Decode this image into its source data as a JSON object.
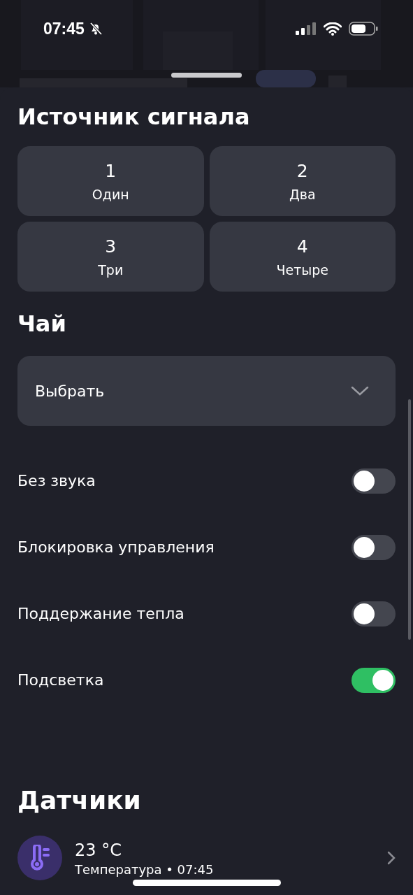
{
  "status_bar": {
    "time": "07:45",
    "silent": true
  },
  "signal_source": {
    "title": "Источник сигнала",
    "options": [
      {
        "number": "1",
        "label": "Один",
        "selected": false
      },
      {
        "number": "2",
        "label": "Два",
        "selected": false
      },
      {
        "number": "3",
        "label": "Три",
        "selected": false
      },
      {
        "number": "4",
        "label": "Четыре",
        "selected": false
      }
    ]
  },
  "tea": {
    "title": "Чай",
    "select": {
      "value": "Выбрать"
    }
  },
  "toggles": [
    {
      "label": "Без звука",
      "on": false
    },
    {
      "label": "Блокировка управления",
      "on": false
    },
    {
      "label": "Поддержание тепла",
      "on": false
    },
    {
      "label": "Подсветка",
      "on": true
    }
  ],
  "sensors": {
    "title": "Датчики",
    "items": [
      {
        "value": "23 °C",
        "caption": "Температура • 07:45"
      }
    ]
  }
}
